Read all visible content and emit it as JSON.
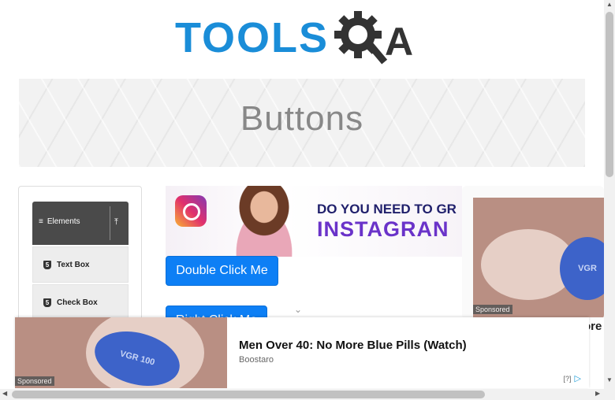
{
  "logo": {
    "text_left": "TOOLS",
    "text_right": "A",
    "icon": "gear-magnifier-icon"
  },
  "banner": {
    "title": "Buttons"
  },
  "sidebar": {
    "group_label": "Elements",
    "items": [
      {
        "label": "Text Box",
        "icon": "html5-icon"
      },
      {
        "label": "Check Box",
        "icon": "html5-icon"
      }
    ]
  },
  "ads": {
    "instagram": {
      "line1": "DO YOU NEED TO GR",
      "line2": "INSTAGRAN"
    },
    "side": {
      "sponsored": "Sponsored",
      "pill_text": "VGR",
      "partial_text": "ore"
    },
    "bottom": {
      "headline": "Men Over 40: No More Blue Pills (Watch)",
      "brand": "Boostaro",
      "sponsored": "Sponsored",
      "pill_text": "VGR 100",
      "info": "[?]"
    }
  },
  "buttons": {
    "double_click": "Double Click Me",
    "right_click": "Right Click Me"
  },
  "colors": {
    "primary_button": "#0d7ff5",
    "sidebar_header": "#4a4a4a",
    "logo_blue": "#1a8dd8"
  }
}
